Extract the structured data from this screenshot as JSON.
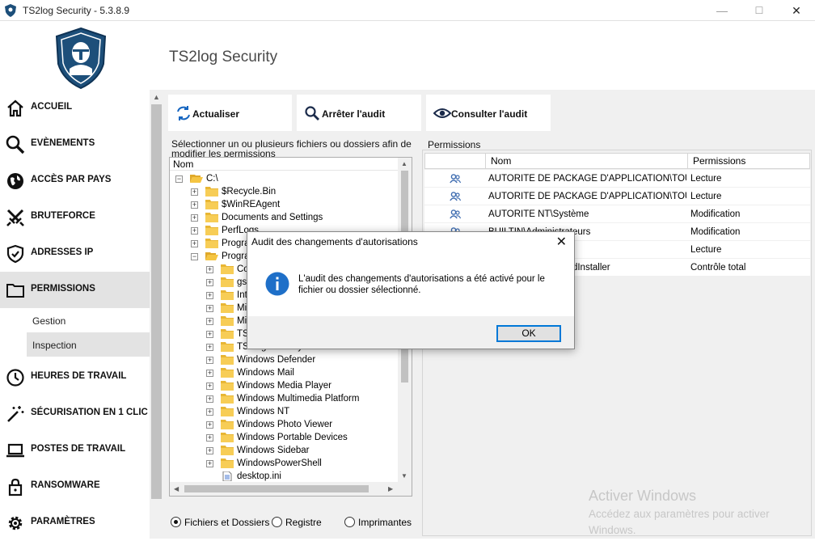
{
  "window": {
    "title": "TS2log Security - 5.3.8.9",
    "minimize": "—",
    "maximize": "☐",
    "close": "✕"
  },
  "header": {
    "app_title": "TS2log Security"
  },
  "sidebar": {
    "items": [
      {
        "label": "ACCUEIL",
        "icon": "home-icon"
      },
      {
        "label": "EVÈNEMENTS",
        "icon": "search-icon"
      },
      {
        "label": "ACCÈS PAR PAYS",
        "icon": "globe-icon"
      },
      {
        "label": "BRUTEFORCE",
        "icon": "swords-icon"
      },
      {
        "label": "ADRESSES IP",
        "icon": "shield-check-icon"
      },
      {
        "label": "PERMISSIONS",
        "icon": "folder-icon"
      },
      {
        "label": "HEURES DE TRAVAIL",
        "icon": "clock-icon"
      },
      {
        "label": "SÉCURISATION EN 1 CLIC",
        "icon": "magic-wand-icon"
      },
      {
        "label": "POSTES DE TRAVAIL",
        "icon": "laptop-icon"
      },
      {
        "label": "RANSOMWARE",
        "icon": "lock-icon"
      },
      {
        "label": "PARAMÈTRES",
        "icon": "gear-icon"
      }
    ],
    "subitems": [
      {
        "label": "Gestion"
      },
      {
        "label": "Inspection"
      }
    ]
  },
  "toolbar": {
    "refresh": "Actualiser",
    "stop_audit": "Arrêter l'audit",
    "view_audit": "Consulter l'audit"
  },
  "tree_panel": {
    "caption": "Sélectionner un ou plusieurs fichiers ou dossiers afin de modifier les permissions",
    "column": "Nom",
    "rows": [
      {
        "name": "C:\\"
      },
      {
        "name": "$Recycle.Bin"
      },
      {
        "name": "$WinREAgent"
      },
      {
        "name": "Documents and Settings"
      },
      {
        "name": "PerfLogs"
      },
      {
        "name": "Program Files"
      },
      {
        "name": "Program Files (x86)"
      },
      {
        "name": "Common Files"
      },
      {
        "name": "gs"
      },
      {
        "name": "Internet Explorer"
      },
      {
        "name": "Microsoft"
      },
      {
        "name": "Microsoft.NET"
      },
      {
        "name": "TS2log"
      },
      {
        "name": "TS2log Security"
      },
      {
        "name": "Windows Defender"
      },
      {
        "name": "Windows Mail"
      },
      {
        "name": "Windows Media Player"
      },
      {
        "name": "Windows Multimedia Platform"
      },
      {
        "name": "Windows NT"
      },
      {
        "name": "Windows Photo Viewer"
      },
      {
        "name": "Windows Portable Devices"
      },
      {
        "name": "Windows Sidebar"
      },
      {
        "name": "WindowsPowerShell"
      },
      {
        "name": "desktop.ini"
      }
    ]
  },
  "filter": {
    "files": "Fichiers et Dossiers",
    "registry": "Registre",
    "printers": "Imprimantes"
  },
  "permissions": {
    "caption": "Permissions",
    "col_name": "Nom",
    "col_perm": "Permissions",
    "rows": [
      {
        "name": "AUTORITÉ DE PACKAGE D'APPLICATION\\TOUS LES PACKAGES D'APPLICATION",
        "perm": "Lecture"
      },
      {
        "name": "AUTORITÉ DE PACKAGE D'APPLICATION\\TOUS LES PACKAGES D'APPLICATION RESTREINTS",
        "perm": "Lecture"
      },
      {
        "name": "AUTORITE NT\\Système",
        "perm": "Modification"
      },
      {
        "name": "BUILTIN\\Administrateurs",
        "perm": "Modification"
      },
      {
        "name": "BUILTIN\\Utilisateurs",
        "perm": "Lecture"
      },
      {
        "name": "NT SERVICE\\TrustedInstaller",
        "perm": "Contrôle total"
      }
    ]
  },
  "dialog": {
    "title": "Audit des changements d'autorisations",
    "message": "L'audit des changements d'autorisations a été activé pour le fichier ou dossier sélectionné.",
    "ok": "OK",
    "close": "✕"
  },
  "watermark": {
    "line1": "Activer Windows",
    "line2": "Accédez aux paramètres pour activer",
    "line3": "Windows."
  },
  "colors": {
    "accent": "#0078d7",
    "shield": "#1d4f7a",
    "folder": "#f5c542"
  }
}
